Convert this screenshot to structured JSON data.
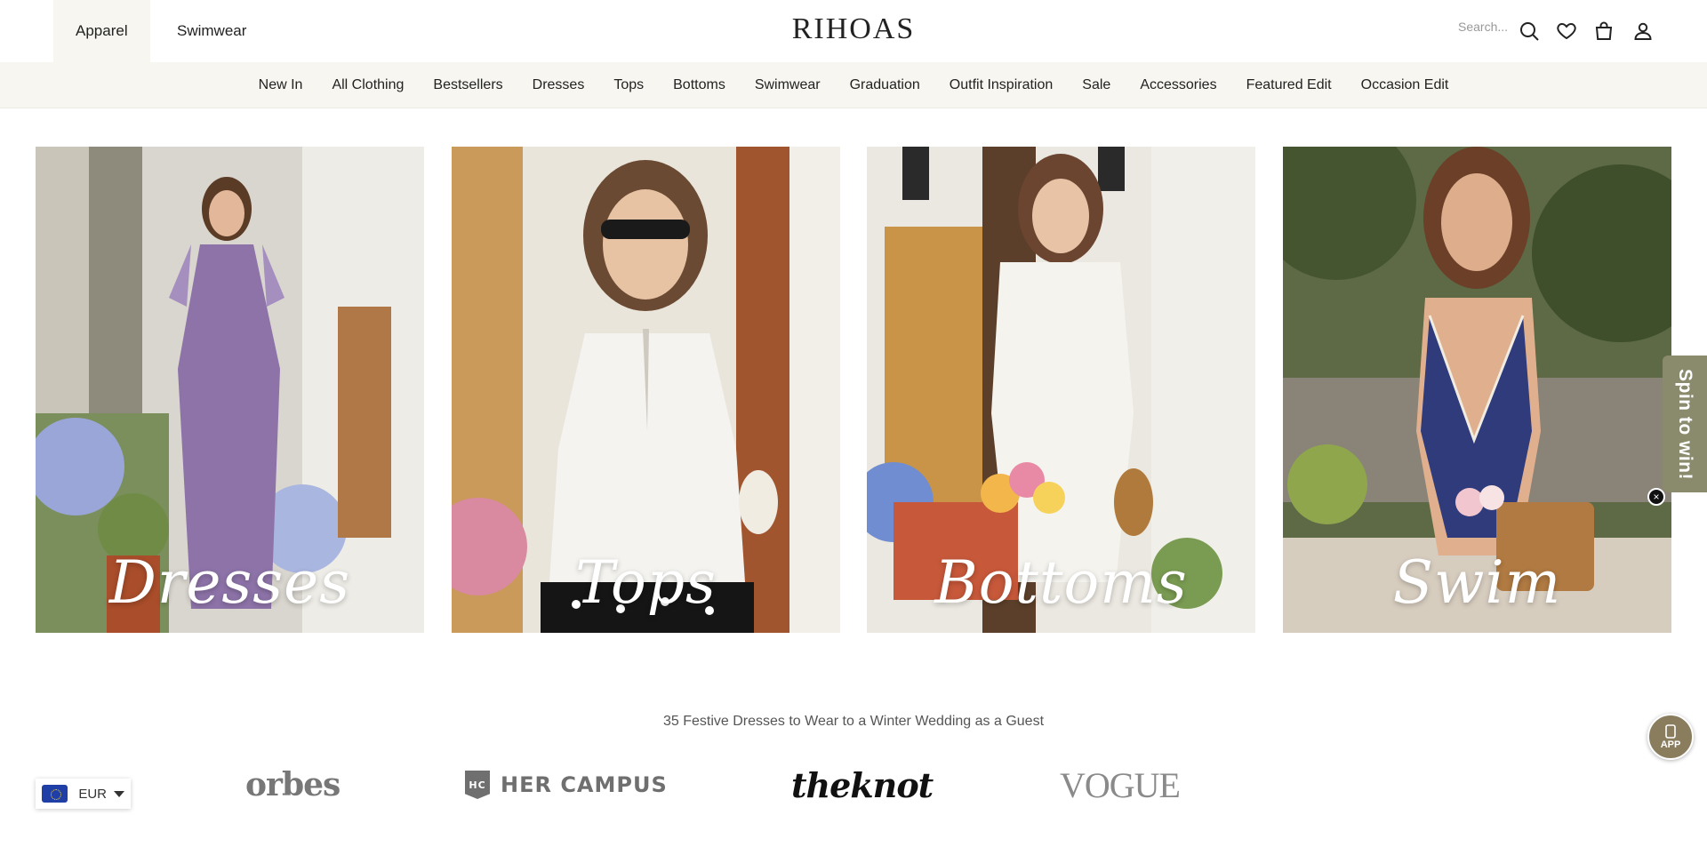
{
  "store_tabs": [
    {
      "label": "Apparel",
      "active": true
    },
    {
      "label": "Swimwear",
      "active": false
    }
  ],
  "logo": "RIHOAS",
  "search": {
    "placeholder": "Search..."
  },
  "header_icons": [
    "search-icon",
    "heart-icon",
    "bag-icon",
    "user-icon"
  ],
  "nav": [
    "New In",
    "All Clothing",
    "Bestsellers",
    "Dresses",
    "Tops",
    "Bottoms",
    "Swimwear",
    "Graduation",
    "Outfit Inspiration",
    "Sale",
    "Accessories",
    "Featured Edit",
    "Occasion Edit"
  ],
  "categories": [
    {
      "label": "Dresses"
    },
    {
      "label": "Tops"
    },
    {
      "label": "Bottoms"
    },
    {
      "label": "Swim"
    }
  ],
  "spin_widget": {
    "label": "Spin to win!",
    "close": "×"
  },
  "press": {
    "title": "35 Festive Dresses to Wear to a Winter Wedding as a Guest",
    "logos": [
      "orbes",
      "HER CAMPUS",
      "theknot",
      "VOGUE"
    ],
    "hc_mark": "HC"
  },
  "currency": {
    "code": "EUR"
  },
  "app_button": {
    "label": "APP"
  },
  "colors": {
    "nav_bg": "#f7f6f0",
    "accent": "#8a8a6c",
    "app": "#8a7d5e"
  }
}
